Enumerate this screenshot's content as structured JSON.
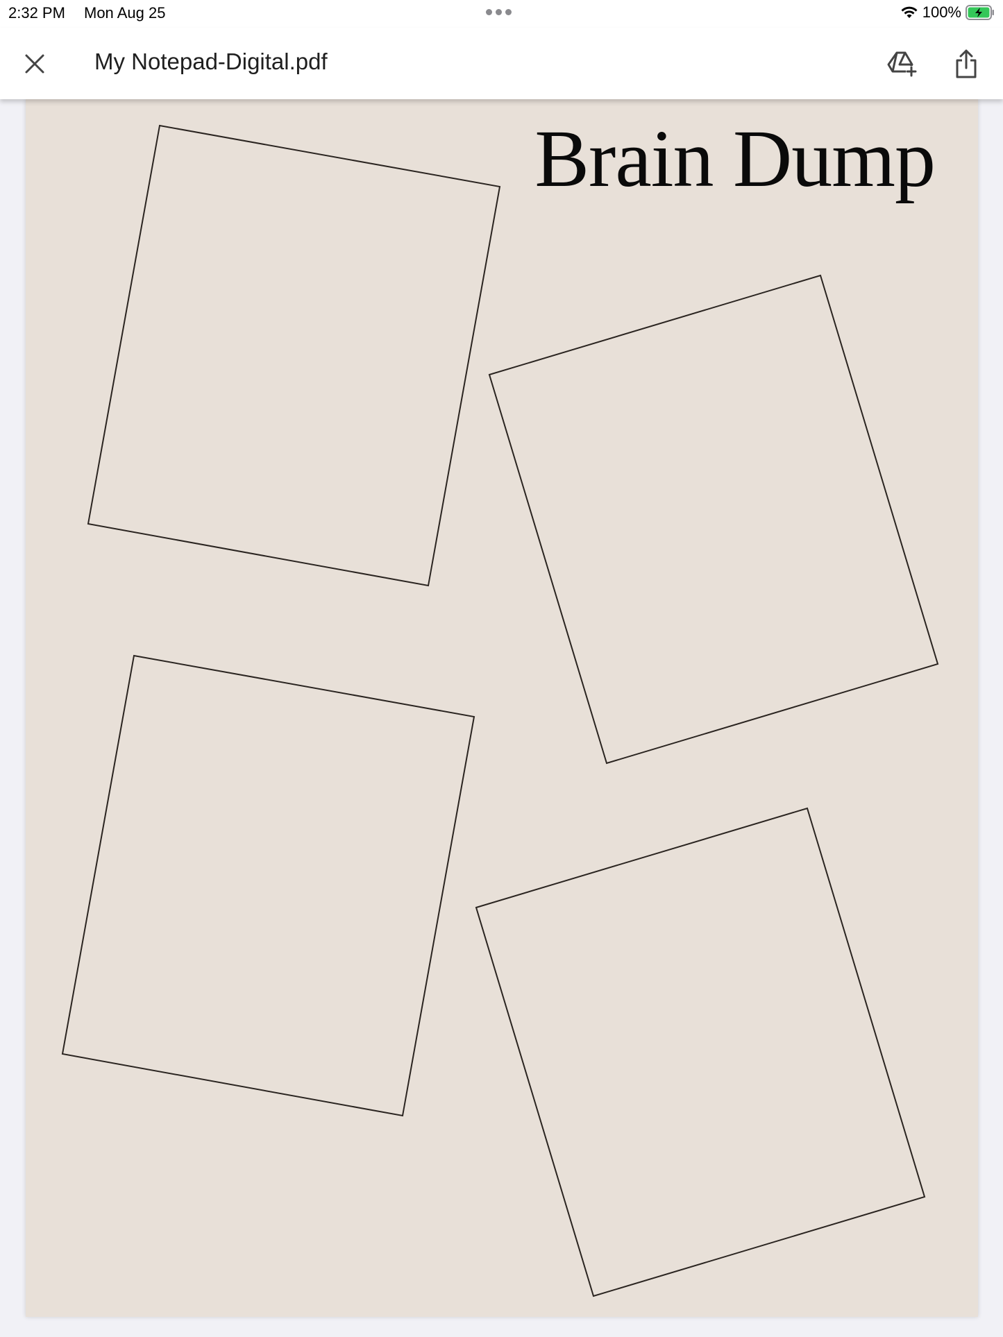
{
  "status_bar": {
    "time": "2:32 PM",
    "date": "Mon Aug 25",
    "battery": "100%",
    "icons": [
      "multitask-dots-icon",
      "wifi-icon",
      "battery-charging-icon"
    ]
  },
  "app_bar": {
    "title": "My Notepad-Digital.pdf",
    "icons": [
      "close-icon",
      "add-to-drive-icon",
      "share-icon"
    ]
  },
  "document": {
    "heading": "Brain Dump",
    "background_color": "#e8e0d8",
    "frames": [
      "note-frame-top-left",
      "note-frame-top-right",
      "note-frame-bottom-left",
      "note-frame-bottom-right"
    ]
  },
  "colors": {
    "battery_green": "#34c759",
    "frame_stroke": "#2a2420"
  }
}
